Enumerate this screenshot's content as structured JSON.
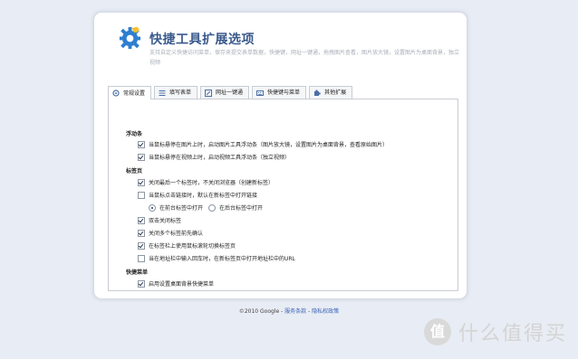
{
  "header": {
    "title": "快捷工具扩展选项",
    "description": "支持自定义快捷访问菜单，保存来提交表单数据，快捷键，网址一键通，拖拽图片查看，图片放大镜，设置图片为桌面背景，独立视频"
  },
  "tabs": [
    {
      "label": "常规设置",
      "icon": "gear-icon",
      "active": true
    },
    {
      "label": "填写表单",
      "icon": "form-icon",
      "active": false
    },
    {
      "label": "网址一键通",
      "icon": "link-icon",
      "active": false
    },
    {
      "label": "快捷键与菜单",
      "icon": "keyboard-icon",
      "active": false
    },
    {
      "label": "其他扩展",
      "icon": "puzzle-icon",
      "active": false
    }
  ],
  "sections": {
    "floating": {
      "heading": "浮动条",
      "items": [
        {
          "label": "当鼠标悬停在图片上时，启动图片工具浮动条（图片放大镜，设置图片为桌面背景，查看原始图片）",
          "checked": true
        },
        {
          "label": "当鼠标悬停在视频上时，启动视频工具浮动条（独立视频）",
          "checked": true
        }
      ]
    },
    "tabs": {
      "heading": "标签页",
      "items": [
        {
          "label": "关闭最后一个标签时，不关闭浏览器（创建新标签）",
          "checked": true
        },
        {
          "label": "当鼠标点击链接时，默认在新标签中打开链接",
          "checked": false
        },
        {
          "label": "双击关闭标签",
          "checked": true
        },
        {
          "label": "关闭多个标签前先确认",
          "checked": true
        },
        {
          "label": "在标签栏上使用鼠标滚轮切换标签页",
          "checked": true
        },
        {
          "label": "当在地址栏中输入回车时，在新标签页中打开地址栏中的URL",
          "checked": false
        }
      ],
      "radios": [
        {
          "label": "在前台标签中打开",
          "checked": true
        },
        {
          "label": "在后台标签中打开",
          "checked": false
        }
      ]
    },
    "menu": {
      "heading": "快捷菜单",
      "items": [
        {
          "label": "启用设置桌面背景快捷菜单",
          "checked": true
        }
      ]
    }
  },
  "footer": {
    "copyright": "©2010 Google - ",
    "terms_link": "服务条款",
    "separator": " - ",
    "privacy_link": "隐私权政策"
  },
  "watermark": {
    "badge": "值",
    "text": "什么值得买"
  }
}
